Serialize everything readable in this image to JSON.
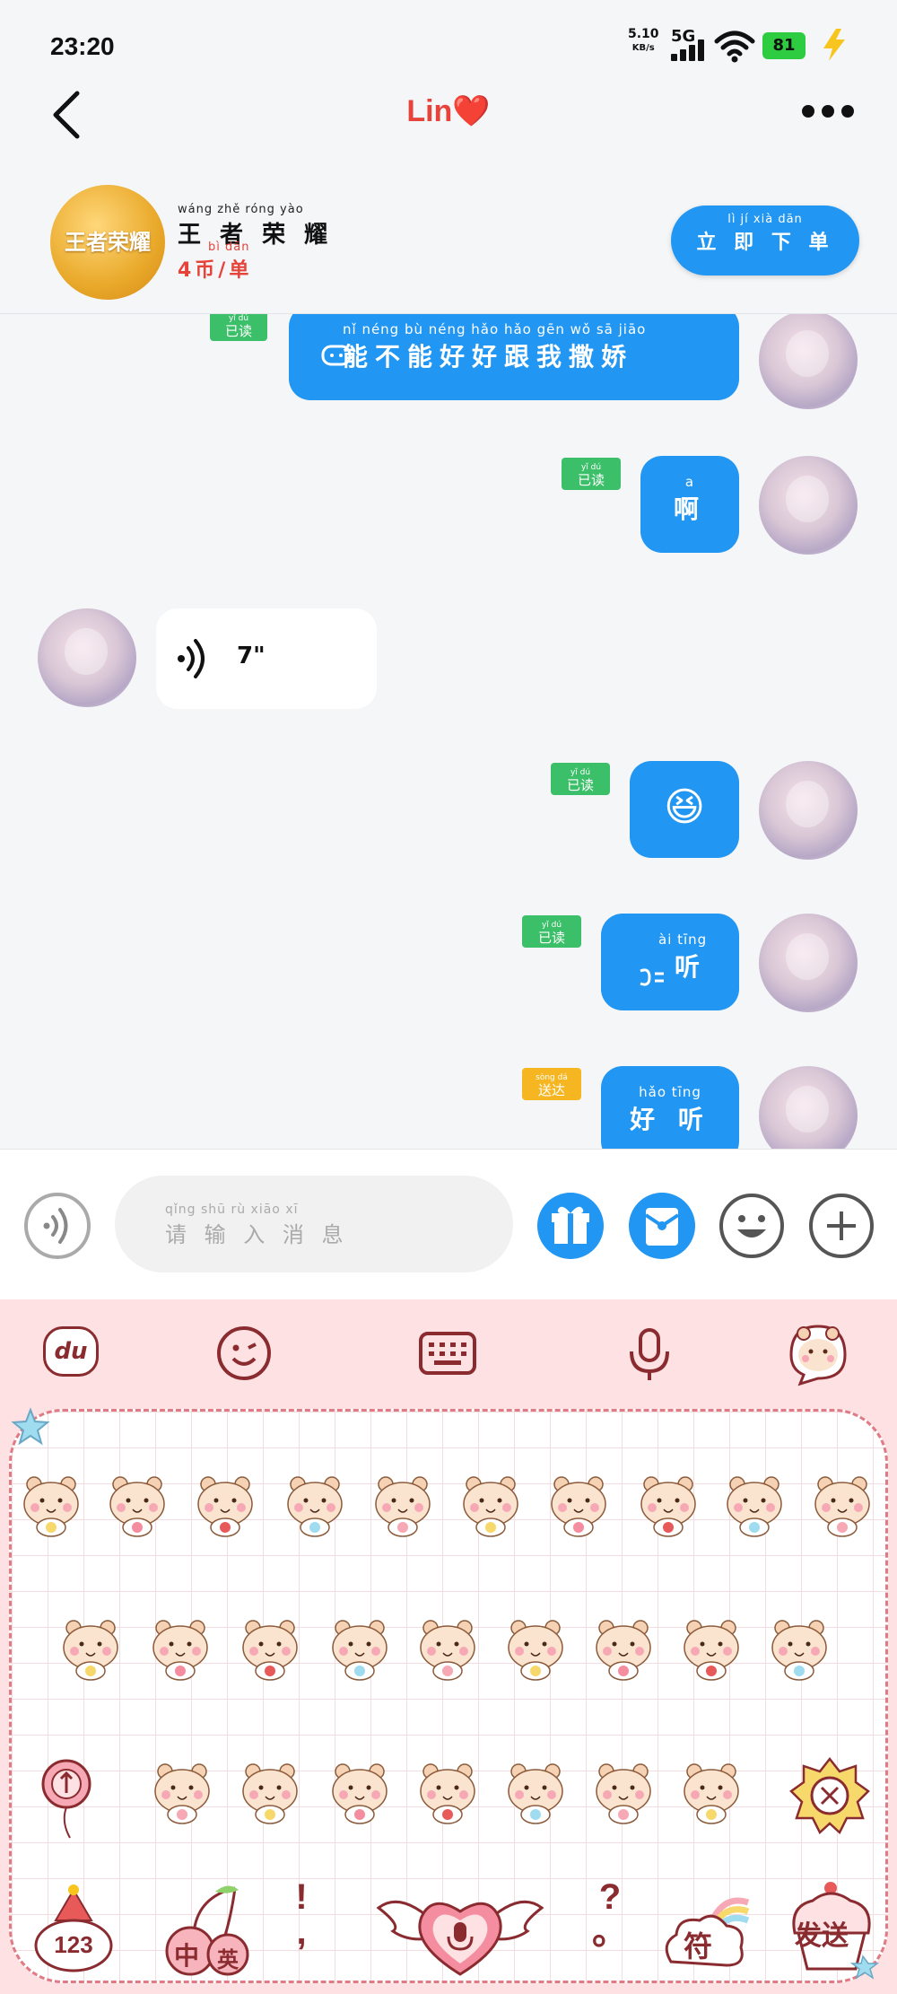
{
  "status_bar": {
    "time": "23:20",
    "net_speed": "5.10",
    "net_speed_unit": "KB/s",
    "network": "5G",
    "battery": "81"
  },
  "header": {
    "title": "Lin❤️"
  },
  "game_bar": {
    "logo_text": "王者荣耀",
    "name_pinyin": "wáng zhě róng yào",
    "name": "王 者 荣 耀",
    "price_pinyin": "bì  dān",
    "price": "4币/单",
    "order_pinyin": "lì  jí  xià  dān",
    "order_label": "立 即 下 单"
  },
  "messages": [
    {
      "side": "out",
      "pinyin": "nǐ néng bù néng hǎo hǎo gēn wǒ sā jiāo",
      "text": "能不能好好跟我撒娇",
      "status_pinyin": "yǐ dú",
      "status": "已读"
    },
    {
      "side": "out",
      "pinyin": "a",
      "text": "啊",
      "status_pinyin": "yǐ dú",
      "status": "已读"
    },
    {
      "side": "in",
      "type": "voice",
      "duration": "7\""
    },
    {
      "side": "out",
      "text": "😆",
      "status_pinyin": "yǐ dú",
      "status": "已读"
    },
    {
      "side": "out",
      "pinyin": "ài tīng",
      "text": "听",
      "status_pinyin": "yǐ dú",
      "status": "已读"
    },
    {
      "side": "out",
      "pinyin": "hǎo tīng",
      "text": "好 听",
      "status_pinyin": "sòng dá",
      "status": "送达"
    }
  ],
  "input": {
    "placeholder_pinyin": "qǐng shū rù xiāo xī",
    "placeholder": "请 输 入 消 息"
  },
  "keyboard": {
    "toolbar": [
      "du",
      "emoji-icon",
      "keyboard-icon",
      "mic-icon",
      "hamster-skin-icon"
    ],
    "keys": {
      "num": "123",
      "lang_zh": "中",
      "lang_en": "英",
      "punct_top": "!",
      "punct_bottom": ",",
      "q_top": "?",
      "q_bottom": "。",
      "symbol": "符",
      "send": "发送"
    }
  },
  "colors": {
    "accent": "#2196f3",
    "read_badge": "#3bbf69",
    "delivered_badge": "#f5b621",
    "title_red": "#e6433a",
    "keyboard_bg": "#fde1e3"
  }
}
